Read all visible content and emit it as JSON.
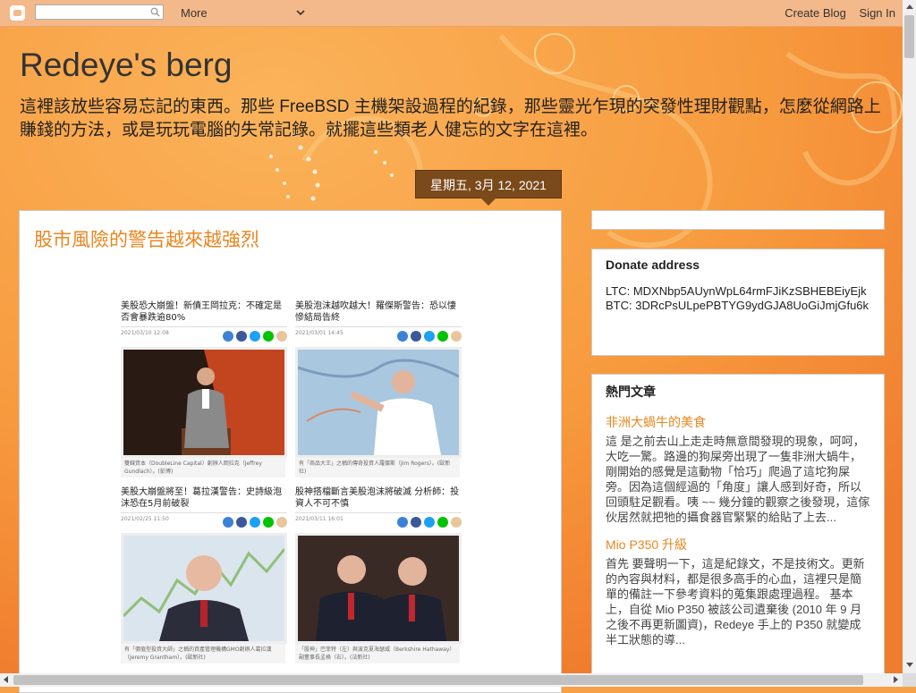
{
  "navbar": {
    "search_placeholder": "",
    "more_label": "More",
    "create_blog": "Create Blog",
    "sign_in": "Sign In"
  },
  "header": {
    "title": "Redeye's berg",
    "description": "這裡該放些容易忘記的東西。那些 FreeBSD 主機架設過程的紀錄，那些靈光乍現的突發性理財觀點，怎麼從網路上賺錢的方法，或是玩玩電腦的失常記錄。就擺這些類老人健忘的文字在這裡。"
  },
  "post": {
    "date": "星期五, 3月 12, 2021",
    "title": "股市風險的警告越來越強烈",
    "news": [
      {
        "headline": "美股恐大崩盤！新債王岡拉克：不確定是否會暴跌逾80%",
        "date": "2021/03/10 12:08",
        "caption": "雙線資本（DoubleLine Capital）創辦人岡拉克（Jeffrey Gundlach）。(彭博)"
      },
      {
        "headline": "美股泡沫越吹越大！羅傑斯警告：恐以悽慘結局告終",
        "date": "2021/03/01 14:45",
        "caption": "有「商品大王」之稱的傳奇投資人羅傑斯（Jim Rogers）。(歐新社)"
      },
      {
        "headline": "美股大崩盤將至！葛拉漢警告：史詩級泡沫恐在5月前破裂",
        "date": "2021/02/25 11:50",
        "caption": "有「價值型投資大師」之稱的資產管理機構GMO創辦人葛拉漢（Jeremy Grantham）。(歐新社)"
      },
      {
        "headline": "股神搭檔斷言美股泡沫將破滅 分析師：投資人不可不慎",
        "date": "2021/03/11 16:01",
        "caption": "「股神」巴菲特（左）與波克夏海瑟威（Berkshire Hathaway）副董事長孟格（右）。(法新社)"
      }
    ]
  },
  "sidebar": {
    "donate": {
      "title": "Donate address",
      "ltc": "LTC: MDXNbp5AUynWpL64rmFJiKzSBHEBEiyEjk",
      "btc": "BTC: 3DRcPsULpePBTYG9ydGJA8UoGiJmjGfu6k"
    },
    "popular": {
      "title": "熱門文章",
      "items": [
        {
          "title": "非洲大蝸牛的美食",
          "snippet": "這 是之前去山上走走時無意間發現的現象，呵呵，大吃一驚。路邊的狗屎旁出現了一隻非洲大蝸牛，剛開始的感覺是這動物「恰巧」爬過了這坨狗屎旁。因為這個經過的「角度」讓人感到好奇，所以回頭駐足觀看。咦 ~~ 幾分鐘的觀察之後發現，這傢伙居然就把牠的攝食器官緊緊的給貼了上去..."
        },
        {
          "title": "Mio P350 升級",
          "snippet": "首先 要聲明一下，這是紀錄文，不是技術文。更新的內容與材料，都是很多高手的心血，這裡只是簡單的備註一下參考資料的蒐集跟處理過程。 基本上，自從 Mio P350 被該公司遺棄後 (2010 年 9 月 之後不再更新圖資)，Redeye 手上的 P350 就變成半工狀態的導..."
        }
      ]
    }
  },
  "colors": {
    "accent": "#e8861f",
    "background": "#f7a047",
    "date_badge": "#7b4a1a"
  }
}
